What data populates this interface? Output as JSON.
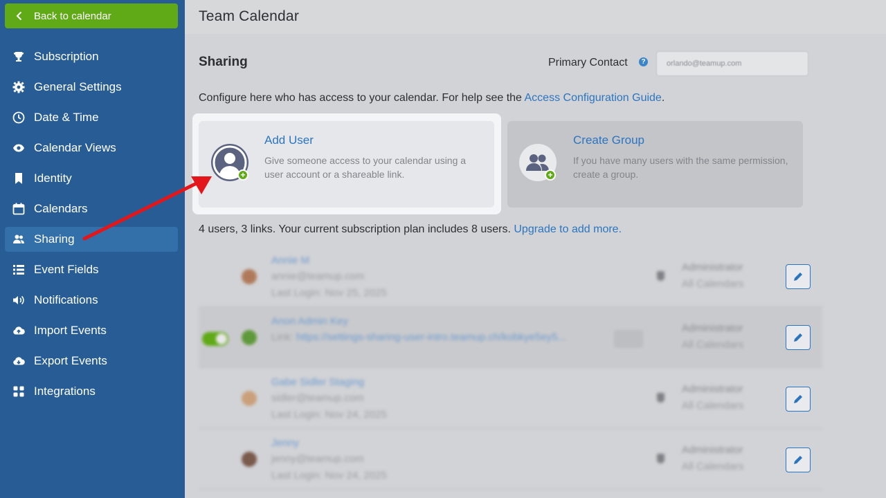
{
  "sidebar": {
    "back_label": "Back to calendar",
    "items": [
      {
        "label": "Subscription",
        "icon": "trophy-icon"
      },
      {
        "label": "General Settings",
        "icon": "gear-icon"
      },
      {
        "label": "Date & Time",
        "icon": "clock-icon"
      },
      {
        "label": "Calendar Views",
        "icon": "eye-icon"
      },
      {
        "label": "Identity",
        "icon": "bookmark-icon"
      },
      {
        "label": "Calendars",
        "icon": "calendar-icon"
      },
      {
        "label": "Sharing",
        "icon": "users-icon",
        "active": true
      },
      {
        "label": "Event Fields",
        "icon": "list-icon"
      },
      {
        "label": "Notifications",
        "icon": "speaker-icon"
      },
      {
        "label": "Import Events",
        "icon": "cloud-upload-icon"
      },
      {
        "label": "Export Events",
        "icon": "cloud-download-icon"
      },
      {
        "label": "Integrations",
        "icon": "grid-icon"
      }
    ]
  },
  "header": {
    "title": "Team Calendar"
  },
  "sharing": {
    "title": "Sharing",
    "primary_contact_label": "Primary Contact",
    "primary_contact_value": "orlando@teamup.com",
    "help_glyph": "?",
    "config_text": "Configure here who has access to your calendar. For help see the ",
    "config_link": "Access Configuration Guide",
    "config_end": ".",
    "add_user": {
      "title": "Add User",
      "desc": "Give someone access to your calendar using a user account or a shareable link."
    },
    "create_group": {
      "title": "Create Group",
      "desc": "If you have many users with the same permission, create a group."
    },
    "plan_text": "4 users, 3 links. Your current subscription plan includes 8 users. ",
    "plan_link": "Upgrade to add more."
  },
  "users": [
    {
      "name": "Annie M",
      "email": "annie@teamup.com",
      "login": "Last Login: Nov 25, 2025",
      "role": "Administrator",
      "calendars": "All Calendars"
    },
    {
      "name": "Anon Admin Key",
      "link_label": "Link: ",
      "link": "https://settings-sharing-user-intro.teamup.ch/kobkye5ey5...",
      "role": "Administrator",
      "calendars": "All Calendars"
    },
    {
      "name": "Gabe Sidler Staging",
      "email": "sidler@teamup.com",
      "login": "Last Login: Nov 24, 2025",
      "role": "Administrator",
      "calendars": "All Calendars"
    },
    {
      "name": "Jenny",
      "email": "jenny@teamup.com",
      "login": "Last Login: Nov 24, 2025",
      "role": "Administrator",
      "calendars": "All Calendars"
    }
  ],
  "colors": {
    "sidebar": "#275d94",
    "accent_green": "#5faa16",
    "link_blue": "#2b75bf",
    "arrow_red": "#e3161b"
  }
}
